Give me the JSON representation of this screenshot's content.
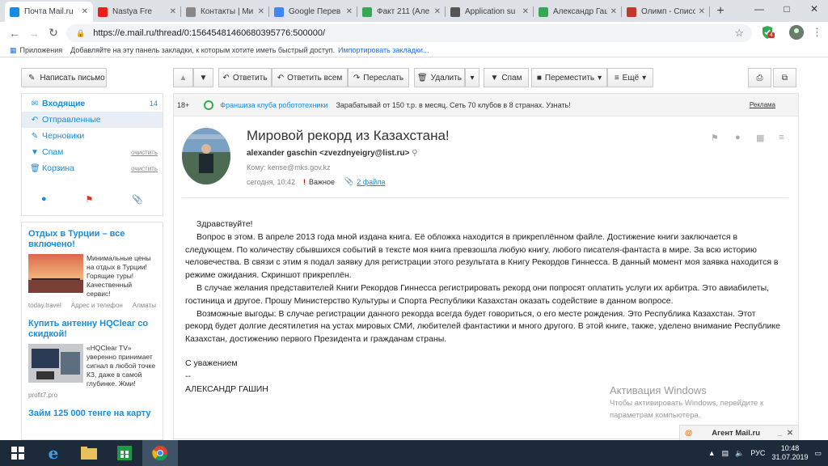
{
  "browser": {
    "tabs": [
      {
        "title": "Почта Mail.ru",
        "color": "#168de2",
        "active": true
      },
      {
        "title": "Nastya Fre",
        "color": "#e62117",
        "active": false
      },
      {
        "title": "Контакты | Ми",
        "color": "#888888",
        "active": false
      },
      {
        "title": "Google Перев",
        "color": "#4285f4",
        "active": false
      },
      {
        "title": "Факт 211 (Але",
        "color": "#34a853",
        "active": false
      },
      {
        "title": "Application su",
        "color": "#555555",
        "active": false
      },
      {
        "title": "Александр Гаш",
        "color": "#34a853",
        "active": false
      },
      {
        "title": "Олимп - Списо",
        "color": "#c0392b",
        "active": false
      }
    ],
    "new_tab": "+",
    "url": "https://e.mail.ru/thread/0:15645481460680395776:500000/",
    "ext_badge": "4",
    "bookmarks": {
      "apps": "Приложения",
      "hint": "Добавляйте на эту панель закладки, к которым хотите иметь быстрый доступ.",
      "import": "Импортировать закладки..."
    }
  },
  "toolbar": {
    "compose": "Написать письмо",
    "reply": "Ответить",
    "reply_all": "Ответить всем",
    "forward": "Переслать",
    "delete": "Удалить",
    "spam": "Спам",
    "move": "Переместить",
    "more": "Ещё"
  },
  "folders": [
    {
      "name": "Входящие",
      "count": "14",
      "clear": ""
    },
    {
      "name": "Отправленные",
      "count": "",
      "clear": ""
    },
    {
      "name": "Черновики",
      "count": "",
      "clear": ""
    },
    {
      "name": "Спам",
      "count": "",
      "clear": "очистить"
    },
    {
      "name": "Корзина",
      "count": "",
      "clear": "очистить"
    }
  ],
  "ads": [
    {
      "title": "Отдых в Турции – все включено!",
      "text": "Минимальные цены на отдых в Турции! Горящие туры! Качественный сервис!",
      "source": "today.travel",
      "address": "Адрес и телефон",
      "city": "Алматы"
    },
    {
      "title": "Купить антенну HQClear со скидкой!",
      "text": "«HQClear TV» уверенно принимает сигнал в любой точке КЗ, даже в самой глубинке. Жми!",
      "source": "profit7.pro"
    },
    {
      "title": "Займ 125 000 тенге на карту"
    }
  ],
  "adstrip": {
    "age": "18+",
    "name": "Франшиза клуба робототехники",
    "text": "Зарабатывай от 150 т.р. в месяц. Сеть 70 клубов в 8 странах. Узнать!",
    "link": "Реклама"
  },
  "message": {
    "subject": "Мировой рекорд из Казахстана!",
    "sender": "alexander gaschin <zvezdnyeigry@list.ru>",
    "to": "Кому: kense@mks.gov.kz",
    "date": "сегодня, 10:42",
    "important": "Важное",
    "attachments": "2 файла",
    "greeting": "Здравствуйте!",
    "p1": "Вопрос в этом. В апреле 2013 года мной издана книга. Её обложка находится в прикреплённом файле. Достижение книги заключается в следующем. По количеству сбывшихся событий в тексте моя книга превзошла любую книгу, любого писателя-фантаста в мире. За всю историю человечества. В связи с этим я подал заявку для регистрации этого результата в Книгу Рекордов Гиннесса. В данный момент моя заявка находится в режиме ожидания. Скриншот прикреплён.",
    "p2": "В случае желания представителей Книги Рекордов Гиннесса регистрировать рекорд они попросят оплатить услуги их арбитра. Это авиабилеты, гостиница и другое. Прошу Министерство Культуры и Спорта Республики Казахстан оказать содействие в данном вопросе.",
    "p3": "Возможные выгоды: В случае регистрации данного рекорда всегда будет говориться, о его месте рождения. Это Республика Казахстан. Этот рекорд будет долгие десятилетия на устах мировых СМИ, любителей фантастики и много другого. В этой книге, также, уделено внимание Республике Казахстан, достижению первого Президента  и гражданам страны.",
    "regards": "С уважением",
    "dash": "--",
    "signature": "АЛЕКСАНДР ГАШИН"
  },
  "watermark": {
    "title": "Активация Windows",
    "line1": "Чтобы активировать Windows, перейдите к",
    "line2": "параметрам компьютера."
  },
  "agent": "Агент Mail.ru",
  "taskbar": {
    "lang": "РУС",
    "time": "10:48",
    "date": "31.07.2019"
  }
}
